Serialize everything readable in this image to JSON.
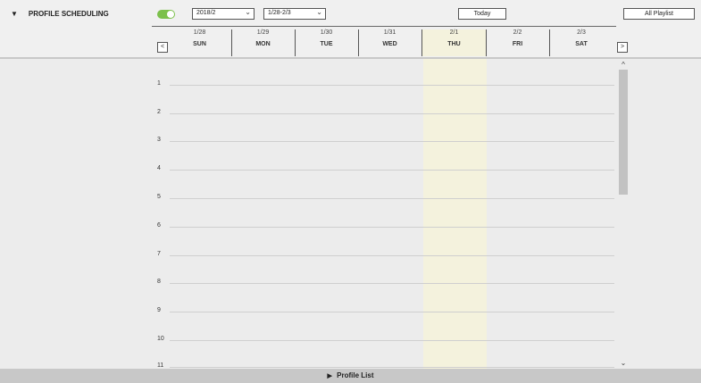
{
  "header": {
    "collapse_glyph": "▼",
    "title": "PROFILE SCHEDULING",
    "toggle_on": true,
    "month_select": "2018/2",
    "week_select": "1/28-2/3",
    "today_label": "Today",
    "all_playlist_label": "All Playlist",
    "prev_label": "<",
    "next_label": ">"
  },
  "days": [
    {
      "date": "1/28",
      "dow": "SUN"
    },
    {
      "date": "1/29",
      "dow": "MON"
    },
    {
      "date": "1/30",
      "dow": "TUE"
    },
    {
      "date": "1/31",
      "dow": "WED"
    },
    {
      "date": "2/1",
      "dow": "THU",
      "today": true
    },
    {
      "date": "2/2",
      "dow": "FRI"
    },
    {
      "date": "2/3",
      "dow": "SAT"
    }
  ],
  "hours": [
    "1",
    "2",
    "3",
    "4",
    "5",
    "6",
    "7",
    "8",
    "9",
    "10",
    "11"
  ],
  "footer": {
    "glyph": "▶",
    "label": "Profile List"
  },
  "colors": {
    "toggle": "#7cc04b",
    "today_highlight": "#f4f2dd"
  }
}
